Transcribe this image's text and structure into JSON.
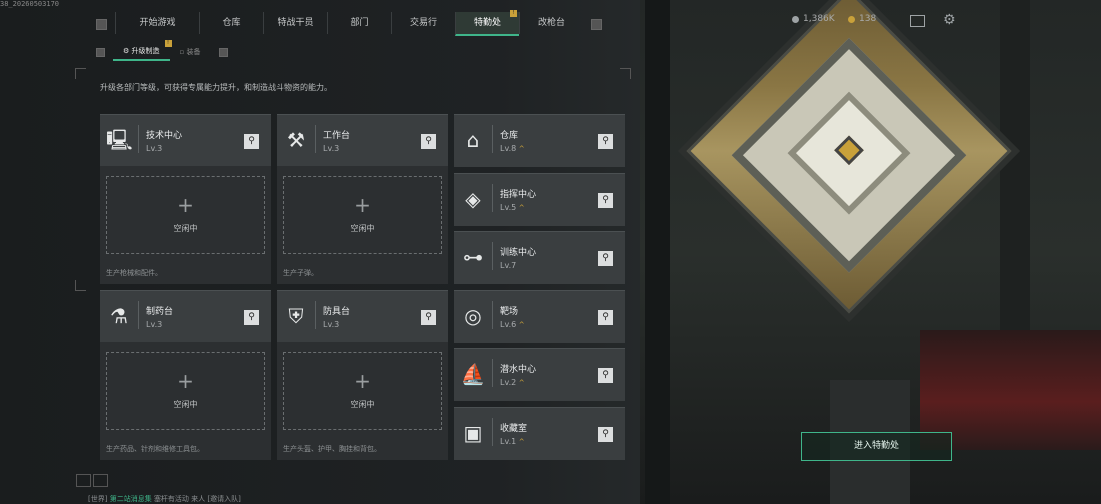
{
  "debug_text": "38_20260503170",
  "nav": {
    "tabs": [
      {
        "label": "开始游戏",
        "active": false
      },
      {
        "label": "仓库",
        "active": false
      },
      {
        "label": "特战干员",
        "active": false
      },
      {
        "label": "部门",
        "active": false
      },
      {
        "label": "交易行",
        "active": false
      },
      {
        "label": "特勤处",
        "active": true,
        "badge": "!"
      },
      {
        "label": "改枪台",
        "active": false
      }
    ],
    "res1": "1,386K",
    "res2": "138"
  },
  "subtabs": [
    {
      "label": "升级制造",
      "active": true,
      "badge": "!"
    },
    {
      "label": "装备",
      "active": false
    }
  ],
  "description": "升级各部门等级，可获得专属能力提升，和制造战斗物资的能力。",
  "facilities_left": [
    {
      "name": "技术中心",
      "level": "Lv.3",
      "icon": "monitor-icon",
      "idle": "空闲中",
      "prod": "生产枪械和配件。"
    },
    {
      "name": "工作台",
      "level": "Lv.3",
      "icon": "tools-icon",
      "idle": "空闲中",
      "prod": "生产子弹。"
    },
    {
      "name": "制药台",
      "level": "Lv.3",
      "icon": "microscope-icon",
      "idle": "空闲中",
      "prod": "生产药品、针剂和维修工具包。"
    },
    {
      "name": "防具台",
      "level": "Lv.3",
      "icon": "armor-icon",
      "idle": "空闲中",
      "prod": "生产头盔、护甲、胸挂和背包。"
    }
  ],
  "facilities_right": [
    {
      "name": "仓库",
      "level": "Lv.8",
      "icon": "warehouse-icon",
      "up": "^"
    },
    {
      "name": "指挥中心",
      "level": "Lv.5",
      "icon": "command-icon",
      "up": "^"
    },
    {
      "name": "训练中心",
      "level": "Lv.7",
      "icon": "dumbbell-icon",
      "up": ""
    },
    {
      "name": "靶场",
      "level": "Lv.6",
      "icon": "target-icon",
      "up": "^"
    },
    {
      "name": "潜水中心",
      "level": "Lv.2",
      "icon": "diving-icon",
      "up": "^"
    },
    {
      "name": "收藏室",
      "level": "Lv.1",
      "icon": "collection-icon",
      "up": "^"
    }
  ],
  "enter_button": "进入特勤处",
  "chat": {
    "channel": "[世界]",
    "name": "第二站消息集",
    "msg": "塞杆有活动",
    "extra": "来人",
    "link": "[邀请入队]"
  },
  "colors": {
    "accent": "#3fb58a",
    "badge": "#c9a13a"
  }
}
